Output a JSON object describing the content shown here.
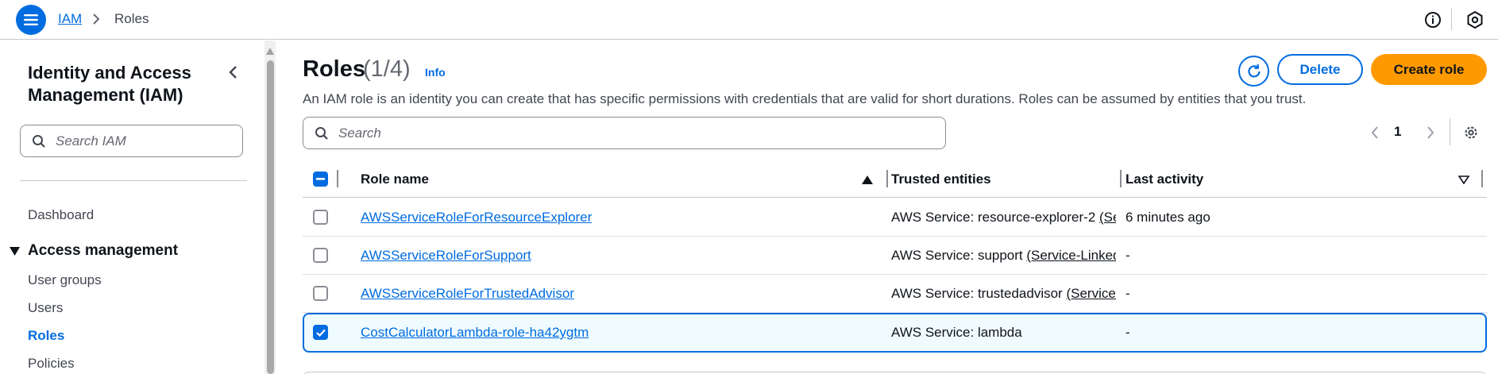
{
  "topbar": {
    "menu_icon": "hamburger-menu-icon",
    "breadcrumb": {
      "root": "IAM",
      "current": "Roles"
    },
    "info_icon": "info-icon",
    "settings_icon": "hexagon-settings-icon"
  },
  "sidebar": {
    "title": "Identity and Access Management (IAM)",
    "close_icon": "chevron-left-icon",
    "search_placeholder": "Search IAM",
    "dashboard": "Dashboard",
    "section": "Access management",
    "items": [
      {
        "label": "User groups",
        "active": false
      },
      {
        "label": "Users",
        "active": false
      },
      {
        "label": "Roles",
        "active": true
      },
      {
        "label": "Policies",
        "active": false
      }
    ]
  },
  "main": {
    "title": "Roles",
    "count": "(1/4)",
    "info": "Info",
    "description": "An IAM role is an identity you can create that has specific permissions with credentials that are valid for short durations. Roles can be assumed by entities that you trust.",
    "buttons": {
      "delete": "Delete",
      "create": "Create role"
    },
    "search_placeholder": "Search",
    "pagination": {
      "page": "1"
    },
    "table": {
      "columns": [
        "Role name",
        "Trusted entities",
        "Last activity"
      ],
      "rows": [
        {
          "name": "AWSServiceRoleForResourceExplorer",
          "trust_prefix": "AWS Service: resource-explorer-2 ",
          "trust_link": "(Service-Linked Role)",
          "last": "6 minutes ago",
          "checked": false
        },
        {
          "name": "AWSServiceRoleForSupport",
          "trust_prefix": "AWS Service: support ",
          "trust_link": "(Service-Linked Role)",
          "last": "-",
          "checked": false
        },
        {
          "name": "AWSServiceRoleForTrustedAdvisor",
          "trust_prefix": "AWS Service: trustedadvisor ",
          "trust_link": "(Service-Linked Role)",
          "last": "-",
          "checked": false
        },
        {
          "name": "CostCalculatorLambda-role-ha42ygtm",
          "trust_prefix": "AWS Service: lambda",
          "trust_link": "",
          "last": "-",
          "checked": true
        }
      ]
    }
  },
  "colors": {
    "accent": "#006ce0",
    "primary_button": "#ff9900",
    "selected_row_bg": "#f0fbff"
  }
}
